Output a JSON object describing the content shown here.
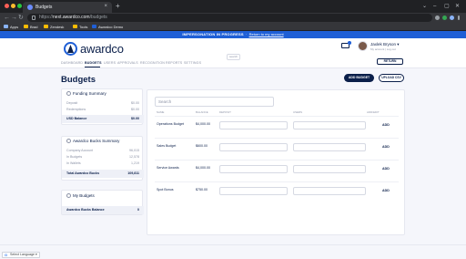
{
  "browser": {
    "tab_title": "Budgets",
    "tab_close": "×",
    "new_tab": "+",
    "window_controls": [
      "⌄",
      "–",
      "▢",
      "✕"
    ],
    "nav_back": "←",
    "nav_forward": "→",
    "nav_reload": "↻",
    "url_scheme": "https://",
    "url_host": "next.awardco.com",
    "url_path": "/budgets",
    "bookmarks": [
      "Apps",
      "Brad",
      "Zendesk",
      "Tools",
      "Awardco Demo"
    ],
    "colors": {
      "close": "#ff5f57",
      "minimize": "#febc2e",
      "maximize": "#28c840"
    }
  },
  "impersonation": {
    "status": "IMPERSONATION IN PROGRESS",
    "link": "Return to my account"
  },
  "header": {
    "logo": "awardco",
    "nav": [
      "DASHBOARD",
      "BUDGETS",
      "USERS",
      "APPROVALS",
      "RECOGNITION",
      "REPORTS",
      "SETTINGS"
    ],
    "active_nav": "BUDGETS",
    "search_chip": "search",
    "user_name": "Jaxlek Bryson ▾",
    "user_sub": "My account | Log out",
    "return_button": "RETURN"
  },
  "page": {
    "title": "Budgets",
    "add_budget": "ADD BUDGET",
    "upload_csv": "UPLOAD CSV"
  },
  "funding_summary": {
    "title": "Funding Summary",
    "rows": [
      {
        "label": "Deposit",
        "value": "$0.00"
      },
      {
        "label": "Redemptions",
        "value": "$0.00"
      }
    ],
    "total_label": "USD Balance",
    "total_value": "$0.00"
  },
  "awardco_bucks_summary": {
    "title": "Awardco Bucks Summary",
    "rows": [
      {
        "label": "Company Account",
        "value": "96,015"
      },
      {
        "label": "In Budgets",
        "value": "12,578"
      },
      {
        "label": "In Wallets",
        "value": "1,219"
      }
    ],
    "total_label": "Total Awardco Bucks",
    "total_value": "109,811"
  },
  "my_budgets": {
    "title": "My Budgets",
    "total_label": "Awardco Bucks Balance",
    "total_value": "0"
  },
  "table": {
    "search_placeholder": "Search",
    "columns": [
      "NAME",
      "BALANCE",
      "DEPOSIT",
      "USERS",
      "ADD/EDIT"
    ],
    "rows": [
      {
        "name": "Operations Budget",
        "balance": "$4,000.00",
        "action": "ADD"
      },
      {
        "name": "Sales Budget",
        "balance": "$600.00",
        "action": "ADD"
      },
      {
        "name": "Service Awards",
        "balance": "$4,000.00",
        "action": "ADD"
      },
      {
        "name": "Spot Bonus",
        "balance": "$750.00",
        "action": "ADD"
      }
    ]
  },
  "footer": {
    "language": "Select Language ▾",
    "google_g": "G"
  }
}
